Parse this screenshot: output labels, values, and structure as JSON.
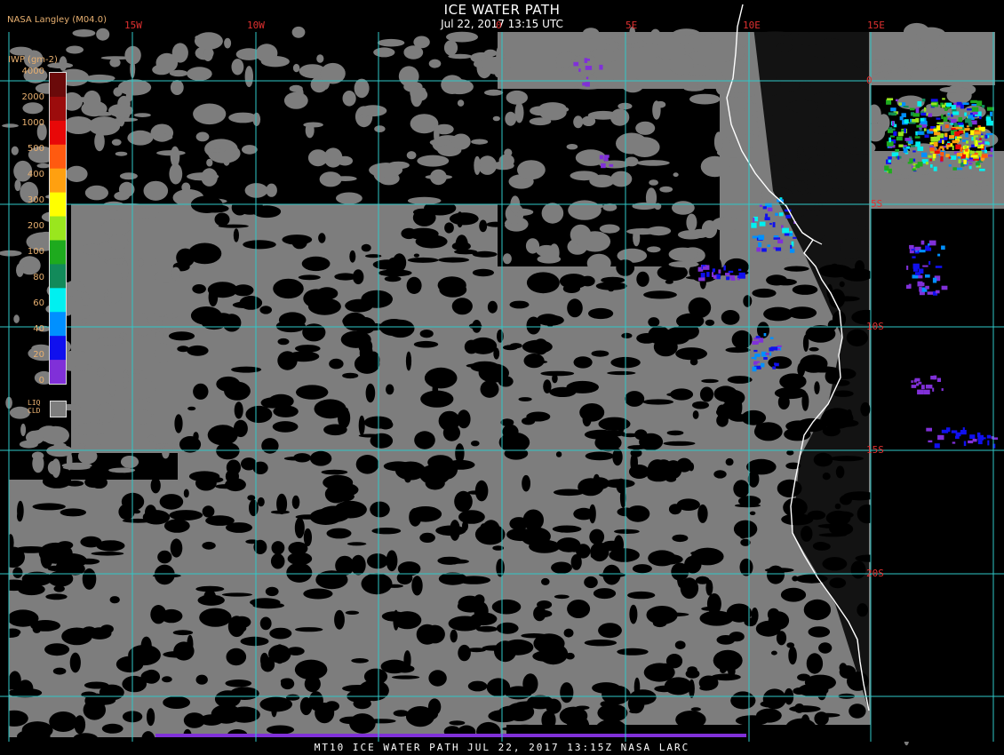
{
  "title": "ICE WATER PATH",
  "subtitle": "Jul 22, 2017 13:15 UTC",
  "producer": "NASA Langley (M04.0)",
  "footer": "MT10  ICE WATER PATH   JUL 22, 2017 13:15Z   NASA LARC",
  "lon_labels": [
    "15W",
    "10W",
    "0",
    "5E",
    "10E",
    "15E"
  ],
  "lat_labels": [
    "0",
    "5S",
    "10S",
    "15S",
    "20S"
  ],
  "colorbar": {
    "title": "IWP (gm-2)",
    "ticks": [
      "4000",
      "2000",
      "1000",
      "500",
      "400",
      "300",
      "200",
      "100",
      "80",
      "60",
      "40",
      "20",
      "0"
    ],
    "colors": [
      "#6a0a0a",
      "#9c0c0c",
      "#e80808",
      "#ff5a10",
      "#ffa010",
      "#ffff00",
      "#9ae61e",
      "#1eaa1e",
      "#128a5a",
      "#00f0f0",
      "#0090ff",
      "#1010ee",
      "#8030d8"
    ],
    "liq_label_1": "LIQ",
    "liq_label_2": "CLD",
    "liq_color": "#7d7d7d"
  },
  "colors": {
    "background": "#000000",
    "cloud": "#7d7d7d",
    "grid": "#30c8c8",
    "coast": "#ffffff",
    "label": "#e03030"
  }
}
